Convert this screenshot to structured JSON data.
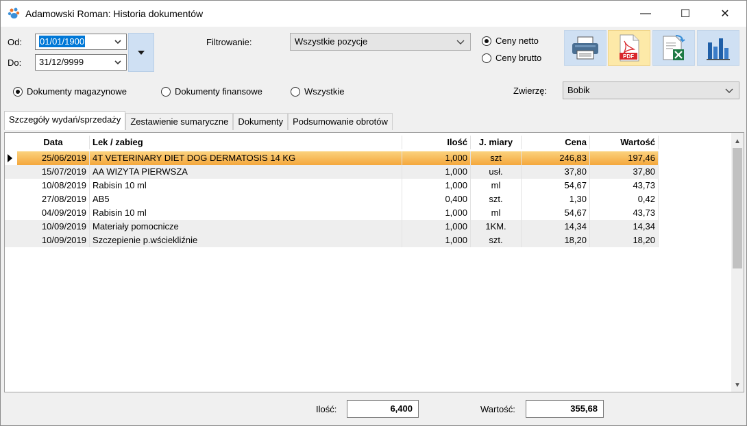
{
  "window": {
    "title": "Adamowski Roman: Historia dokumentów",
    "minimize_glyph": "—",
    "maximize_glyph": "☐",
    "close_glyph": "✕"
  },
  "dates": {
    "from_label": "Od:",
    "from_value": "01/01/1900",
    "to_label": "Do:",
    "to_value": "31/12/9999"
  },
  "filter": {
    "label": "Filtrowanie:",
    "value": "Wszystkie pozycje"
  },
  "price_mode": {
    "net_label": "Ceny netto",
    "gross_label": "Ceny brutto",
    "selected": "net"
  },
  "toolbar": {
    "buttons": [
      {
        "icon": "printer-icon",
        "color": "#cfe0f3"
      },
      {
        "icon": "pdf-icon",
        "color": "#fde9a8"
      },
      {
        "icon": "excel-export-icon",
        "color": "#cfe0f3"
      },
      {
        "icon": "bar-chart-icon",
        "color": "#cfe0f3"
      }
    ]
  },
  "doc_type": {
    "options": [
      "Dokumenty magazynowe",
      "Dokumenty finansowe",
      "Wszystkie"
    ],
    "selected": 0
  },
  "animal": {
    "label": "Zwierzę:",
    "value": "Bobik"
  },
  "tabs": [
    "Szczegóły wydań/sprzedaży",
    "Zestawienie sumaryczne",
    "Dokumenty",
    "Podsumowanie obrotów"
  ],
  "active_tab": 0,
  "table": {
    "columns": [
      "Data",
      "Lek / zabieg",
      "Ilość",
      "J. miary",
      "Cena",
      "Wartość"
    ],
    "rows": [
      [
        "25/06/2019",
        "4T VETERINARY DIET DOG DERMATOSIS 14 KG",
        "1,000",
        "szt",
        "246,83",
        "197,46"
      ],
      [
        "15/07/2019",
        "AA WIZYTA PIERWSZA",
        "1,000",
        "usł.",
        "37,80",
        "37,80"
      ],
      [
        "10/08/2019",
        "Rabisin 10 ml",
        "1,000",
        "ml",
        "54,67",
        "43,73"
      ],
      [
        "27/08/2019",
        "AB5",
        "0,400",
        "szt.",
        "1,30",
        "0,42"
      ],
      [
        "04/09/2019",
        "Rabisin 10 ml",
        "1,000",
        "ml",
        "54,67",
        "43,73"
      ],
      [
        "10/09/2019",
        "Materiały pomocnicze",
        "1,000",
        "1KM.",
        "14,34",
        "14,34"
      ],
      [
        "10/09/2019",
        "Szczepienie p.wściekliźnie",
        "1,000",
        "szt.",
        "18,20",
        "18,20"
      ]
    ],
    "selected_row": 0
  },
  "totals": {
    "qty_label": "Ilość:",
    "qty_value": "6,400",
    "value_label": "Wartość:",
    "value_value": "355,68"
  }
}
